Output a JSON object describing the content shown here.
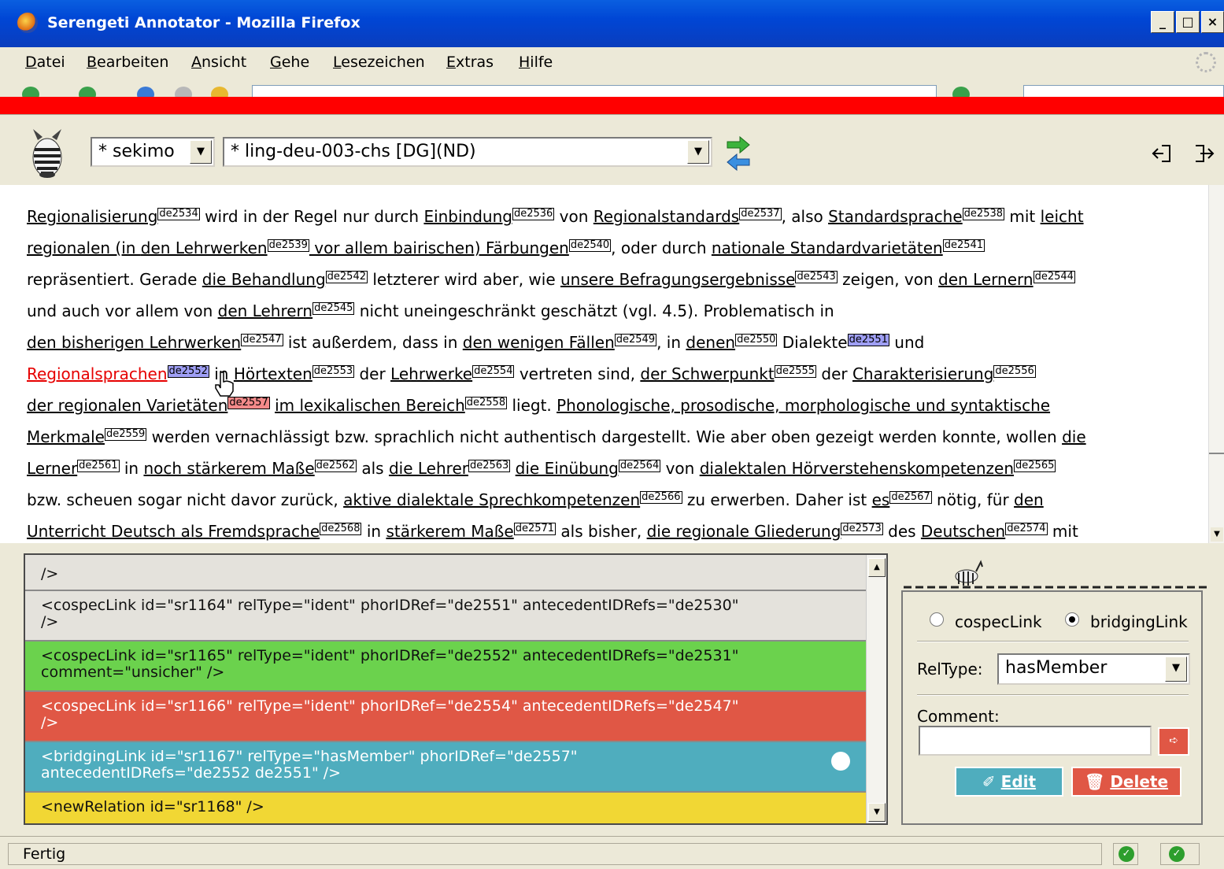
{
  "window": {
    "title": "Serengeti Annotator - Mozilla Firefox"
  },
  "menu": [
    "Datei",
    "Bearbeiten",
    "Ansicht",
    "Gehe",
    "Lesezeichen",
    "Extras",
    "Hilfe"
  ],
  "toolbar": {
    "user_select": "* sekimo",
    "document_select": "* ling-deu-003-chs [DG](ND)"
  },
  "text": {
    "l1": {
      "a": "Regionalisierung",
      "t1": "de2534",
      "b": " wird in der Regel nur durch ",
      "c": "Einbindung",
      "t2": "de2536",
      "d": " von ",
      "e": "Regionalstandards",
      "t3": "de2537",
      "f": ", also ",
      "g": "Standardsprache",
      "t4": "de2538",
      "h": " mit ",
      "i": "leicht"
    },
    "l2": {
      "a": "regionalen (in ",
      "b": "den Lehrwerken",
      "t1": "de2539",
      "c": " vor allem bairischen) Färbungen",
      "t2": "de2540",
      "d": ", oder durch ",
      "e": "nationale Standardvarietäten",
      "t3": "de2541"
    },
    "l3": {
      "a": "repräsentiert. Gerade ",
      "b": "die Behandlung",
      "t1": "de2542",
      "c": " letzterer wird aber, wie ",
      "d": "unsere Befragungsergebnisse",
      "t2": "de2543",
      "e": " zeigen, von ",
      "f": "den Lernern",
      "t3": "de2544"
    },
    "l4": {
      "a": "und auch vor allem von ",
      "b": "den Lehrern",
      "t1": "de2545",
      "c": " nicht uneingeschränkt geschätzt (vgl. 4.5). Problematisch in"
    },
    "l5": {
      "a": "den bisherigen Lehrwerken",
      "t1": "de2547",
      "b": " ist außerdem, dass in ",
      "c": "den wenigen Fällen",
      "t2": "de2549",
      "d": ", in ",
      "e": "denen",
      "t3": "de2550",
      "f": " Dialekte",
      "t4": "de2551",
      "g": " und"
    },
    "l6": {
      "a": "Regionalsprachen",
      "t1": "de2552",
      "b": " in ",
      "c": "Hörtexten",
      "t2": "de2553",
      "d": " der ",
      "e": "Lehrwerke",
      "t3": "de2554",
      "f": " vertreten sind, ",
      "g": "der Schwerpunkt",
      "t4": "de2555",
      "h": " der ",
      "i": "Charakterisierung",
      "t5": "de2556"
    },
    "l7": {
      "a": "der regionalen Varietäten",
      "t1": "de2557",
      "b": " ",
      "c": "im lexikalischen Bereich",
      "t2": "de2558",
      "d": " liegt. ",
      "e": "Phonologische, prosodische, morphologische und syntaktische"
    },
    "l8": {
      "a": "Merkmale",
      "t1": "de2559",
      "b": " werden vernachlässigt bzw. sprachlich nicht authentisch dargestellt. Wie aber oben gezeigt werden konnte, wollen ",
      "c": "die"
    },
    "l9": {
      "a": "Lerner",
      "t1": "de2561",
      "b": " in ",
      "c": "noch stärkerem Maße",
      "t2": "de2562",
      "d": " als ",
      "e": "die Lehrer",
      "t3": "de2563",
      "f": " ",
      "g": "die Einübung",
      "t4": "de2564",
      "h": " von ",
      "i": "dialektalen Hörverstehenskompetenzen",
      "t5": "de2565"
    },
    "l10": {
      "a": "bzw. scheuen sogar nicht davor zurück, ",
      "b": "aktive dialektale Sprechkompetenzen",
      "t1": "de2566",
      "c": " zu erwerben. Daher ist ",
      "d": "es",
      "t2": "de2567",
      "e": " nötig, für ",
      "f": "den"
    },
    "l11": {
      "a": "Unterricht Deutsch als Fremdsprache",
      "t1": "de2568",
      "b": " in ",
      "c": "stärkerem Maße",
      "t2": "de2571",
      "d": " als bisher, ",
      "e": "die regionale Gliederung",
      "t3": "de2573",
      "f": " des ",
      "g": "Deutschen",
      "t4": "de2574",
      "h": " mit"
    }
  },
  "relations": [
    {
      "line1": "/>",
      "line2": ""
    },
    {
      "line1": "<cospecLink id=\"sr1164\" relType=\"ident\" phorIDRef=\"de2551\" antecedentIDRefs=\"de2530\"",
      "line2": "/>"
    },
    {
      "line1": "<cospecLink id=\"sr1165\" relType=\"ident\" phorIDRef=\"de2552\" antecedentIDRefs=\"de2531\"",
      "line2": "comment=\"unsicher\" />"
    },
    {
      "line1": "<cospecLink id=\"sr1166\" relType=\"ident\" phorIDRef=\"de2554\" antecedentIDRefs=\"de2547\"",
      "line2": "/>"
    },
    {
      "line1": "<bridgingLink id=\"sr1167\" relType=\"hasMember\" phorIDRef=\"de2557\"",
      "line2": "antecedentIDRefs=\"de2552 de2551\" />"
    },
    {
      "line1": "<newRelation id=\"sr1168\" />",
      "line2": ""
    }
  ],
  "panel": {
    "radio_cospec": "cospecLink",
    "radio_bridging": "bridgingLink",
    "reltype_label": "RelType:",
    "reltype_value": "hasMember",
    "comment_label": "Comment:",
    "comment_value": "",
    "edit_label": "Edit",
    "delete_label": "Delete"
  },
  "status": {
    "text": "Fertig"
  },
  "colors": {
    "green": "#6bd24d",
    "red": "#e05745",
    "teal": "#4fadbe",
    "yellow": "#f1d734",
    "gray": "#e4e2dc"
  }
}
